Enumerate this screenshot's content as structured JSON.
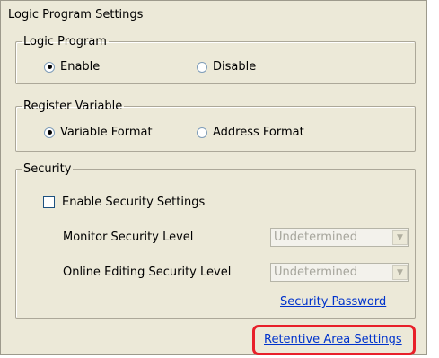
{
  "dialog": {
    "title": "Logic Program Settings",
    "logic_program": {
      "legend": "Logic Program",
      "enable_label": "Enable",
      "disable_label": "Disable",
      "selected": "Enable"
    },
    "register_variable": {
      "legend": "Register Variable",
      "variable_format_label": "Variable Format",
      "address_format_label": "Address Format",
      "selected": "Variable Format"
    },
    "security": {
      "legend": "Security",
      "enable_security_label": "Enable Security Settings",
      "enable_security_checked": false,
      "monitor_level_label": "Monitor Security Level",
      "monitor_level_value": "Undetermined",
      "online_editing_level_label": "Online Editing Security Level",
      "online_editing_level_value": "Undetermined",
      "password_link": "Security Password"
    },
    "retentive_link": "Retentive Area Settings"
  },
  "colors": {
    "highlight": "#e8202a",
    "link": "#0033cc",
    "dialog_bg": "#ece9d8"
  }
}
